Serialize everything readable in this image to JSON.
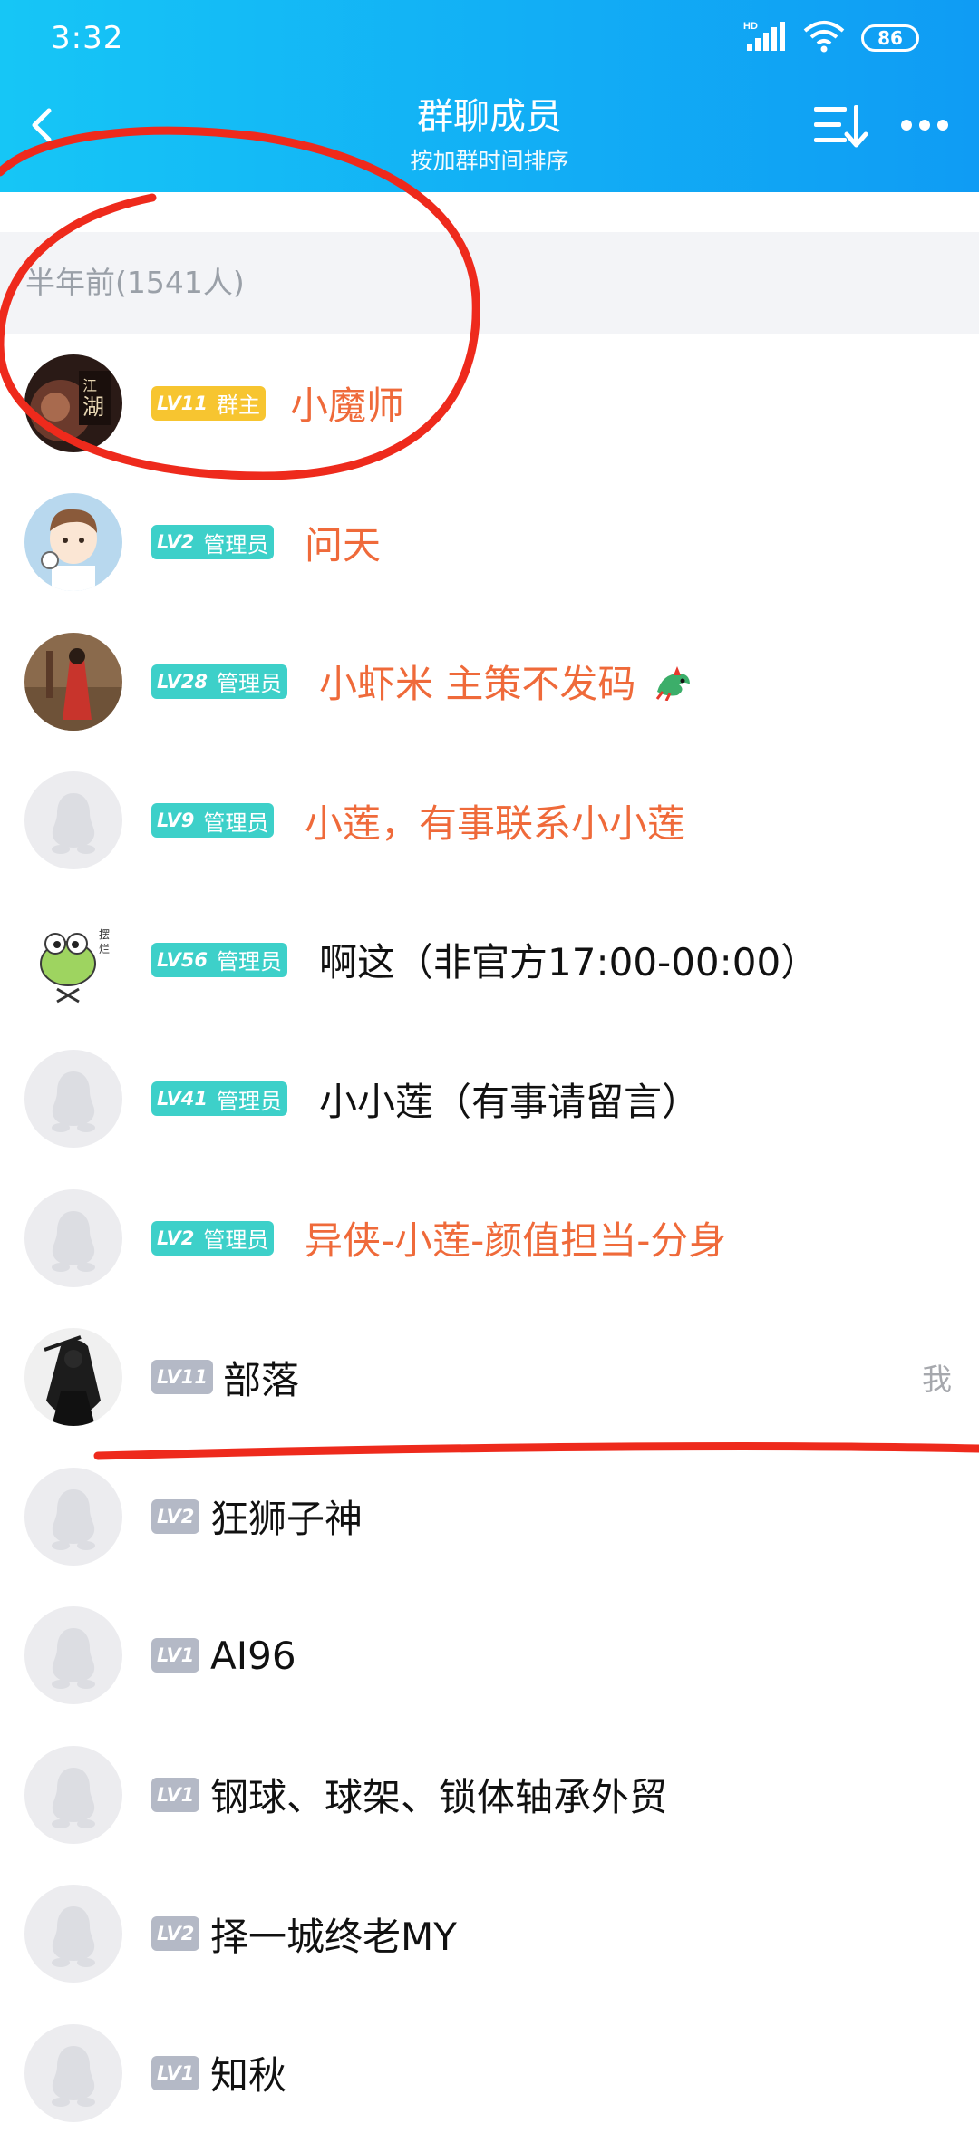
{
  "status_bar": {
    "time": "3:32",
    "hd_label": "HD",
    "battery": "86"
  },
  "nav": {
    "title": "群聊成员",
    "subtitle": "按加群时间排序",
    "back_icon": "chevron-left-icon",
    "sort_icon": "sort-list-icon",
    "more_icon": "more-dots-icon"
  },
  "section": {
    "label": "半年前(1541人)"
  },
  "members": [
    {
      "level": "LV11",
      "role": "群主",
      "name": "小魔师",
      "me": ""
    },
    {
      "level": "LV2",
      "role": "管理员",
      "name": "问天",
      "me": ""
    },
    {
      "level": "LV28",
      "role": "管理员",
      "name": "小虾米 主策不发码",
      "me": ""
    },
    {
      "level": "LV9",
      "role": "管理员",
      "name": "小莲，有事联系小小莲",
      "me": ""
    },
    {
      "level": "LV56",
      "role": "管理员",
      "name": "啊这（非官方17:00-00:00）",
      "me": ""
    },
    {
      "level": "LV41",
      "role": "管理员",
      "name": "小小莲（有事请留言）",
      "me": ""
    },
    {
      "level": "LV2",
      "role": "管理员",
      "name": "异侠-小莲-颜值担当-分身",
      "me": ""
    },
    {
      "level": "LV11",
      "role": "",
      "name": "部落",
      "me": "我"
    },
    {
      "level": "LV2",
      "role": "",
      "name": "狂狮子神",
      "me": ""
    },
    {
      "level": "LV1",
      "role": "",
      "name": "AI96",
      "me": ""
    },
    {
      "level": "LV1",
      "role": "",
      "name": "钢球、球架、锁体轴承外贸",
      "me": ""
    },
    {
      "level": "LV2",
      "role": "",
      "name": "择一城终老MY",
      "me": ""
    },
    {
      "level": "LV1",
      "role": "",
      "name": "知秋",
      "me": ""
    }
  ],
  "colors": {
    "header_gradient_start": "#16c6f6",
    "header_gradient_end": "#0f9cf4",
    "owner_badge": "#f7c530",
    "admin_badge": "#3dd0c9",
    "member_badge": "#b4b9c6",
    "admin_name": "#ef6a3a",
    "annotation_red": "#ee2a1c"
  }
}
